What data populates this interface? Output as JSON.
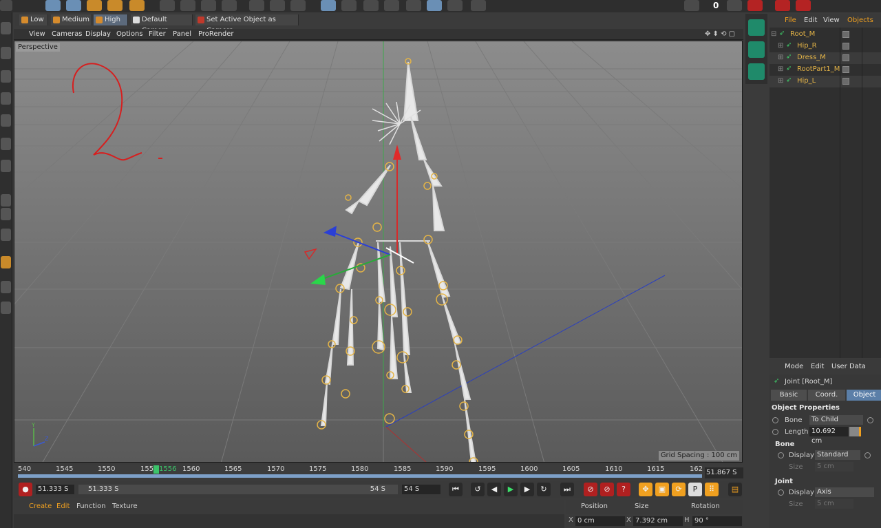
{
  "quality": {
    "low": "Low",
    "medium": "Medium",
    "high": "High",
    "camera": "Default Camera",
    "set_active": "Set Active Object as Camera"
  },
  "toolbar": {
    "frame_counter": "0"
  },
  "viewport_menu": {
    "view": "View",
    "cameras": "Cameras",
    "display": "Display",
    "options": "Options",
    "filter": "Filter",
    "panel": "Panel",
    "prorender": "ProRender"
  },
  "viewport": {
    "label": "Perspective",
    "grid_spacing": "Grid Spacing : 100 cm",
    "annotation": "2"
  },
  "timeline": {
    "ticks": [
      "540",
      "1545",
      "1550",
      "1555",
      "1556",
      "1560",
      "1565",
      "1570",
      "1575",
      "1580",
      "1585",
      "1590",
      "1595",
      "1600",
      "1605",
      "1610",
      "1615",
      "162"
    ],
    "end_value": "51.867 S"
  },
  "transport": {
    "current_time": "51.333 S",
    "slider_value": "51.333 S",
    "slider_end": "54 S",
    "max_time": "54 S"
  },
  "material_menu": {
    "create": "Create",
    "edit": "Edit",
    "function": "Function",
    "texture": "Texture"
  },
  "coords": {
    "position_header": "Position",
    "size_header": "Size",
    "rotation_header": "Rotation",
    "x_label": "X",
    "x_value": "0 cm",
    "size_label": "X",
    "size_value": "7.392 cm",
    "rot_label": "H",
    "rot_value": "90 °"
  },
  "objects_menu": {
    "file": "File",
    "edit": "Edit",
    "view": "View",
    "objects": "Objects"
  },
  "objects": [
    {
      "name": "Root_M"
    },
    {
      "name": "Hip_R"
    },
    {
      "name": "Dress_M"
    },
    {
      "name": "RootPart1_M"
    },
    {
      "name": "Hip_L"
    }
  ],
  "attributes": {
    "menu": {
      "mode": "Mode",
      "edit": "Edit",
      "user_data": "User Data"
    },
    "title": "Joint [Root_M]",
    "tabs": {
      "basic": "Basic",
      "coord": "Coord.",
      "object": "Object"
    },
    "section_object": "Object Properties",
    "bone_label": "Bone",
    "bone_value": "To Child",
    "length_label": "Length",
    "length_value": "10.692 cm",
    "section_bone": "Bone",
    "display_label": "Display",
    "display_bone": "Standard",
    "size_label": "Size",
    "size_bone": "5 cm",
    "section_joint": "Joint",
    "display_joint": "Axis",
    "size_joint": "5 cm"
  },
  "colors": {
    "accent": "#5b7fa8",
    "joint": "#e4b447",
    "annotation": "#d61f1f",
    "playhead": "#3cc36a"
  }
}
